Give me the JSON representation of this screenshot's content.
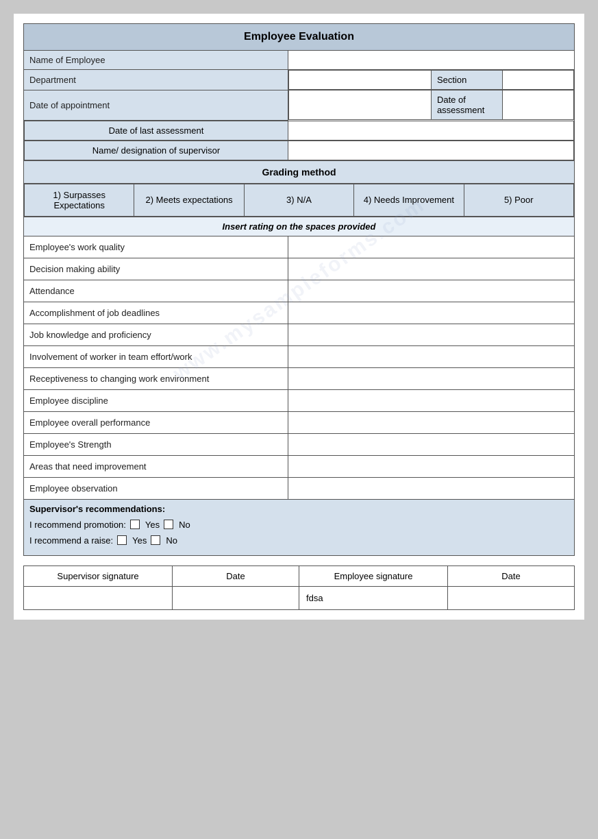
{
  "title": "Employee Evaluation",
  "header": {
    "name_of_employee_label": "Name of Employee",
    "department_label": "Department",
    "section_label": "Section",
    "date_of_appointment_label": "Date of appointment",
    "date_of_assessment_label": "Date of assessment",
    "date_of_last_assessment_label": "Date of last assessment",
    "name_designation_label": "Name/ designation of supervisor"
  },
  "grading": {
    "title": "Grading method",
    "options": [
      "1) Surpasses Expectations",
      "2) Meets expectations",
      "3) N/A",
      "4) Needs Improvement",
      "5) Poor"
    ],
    "insert_text": "Insert rating on the spaces provided"
  },
  "evaluation_items": [
    "Employee's work quality",
    "Decision making ability",
    "Attendance",
    "Accomplishment of job deadlines",
    "Job knowledge and proficiency",
    "Involvement of worker in team effort/work",
    "Receptiveness to changing work environment",
    "Employee discipline",
    "Employee overall performance",
    "Employee's Strength",
    "Areas that need improvement",
    "Employee observation"
  ],
  "recommendations": {
    "title": "Supervisor's recommendations:",
    "promotion_label": "I recommend promotion:",
    "raise_label": "I recommend a raise:",
    "yes_label": "Yes",
    "no_label": "No"
  },
  "signature_table": {
    "cols": [
      "Supervisor signature",
      "Date",
      "Employee signature",
      "Date"
    ],
    "row": [
      "",
      "",
      "fdsa",
      ""
    ]
  }
}
